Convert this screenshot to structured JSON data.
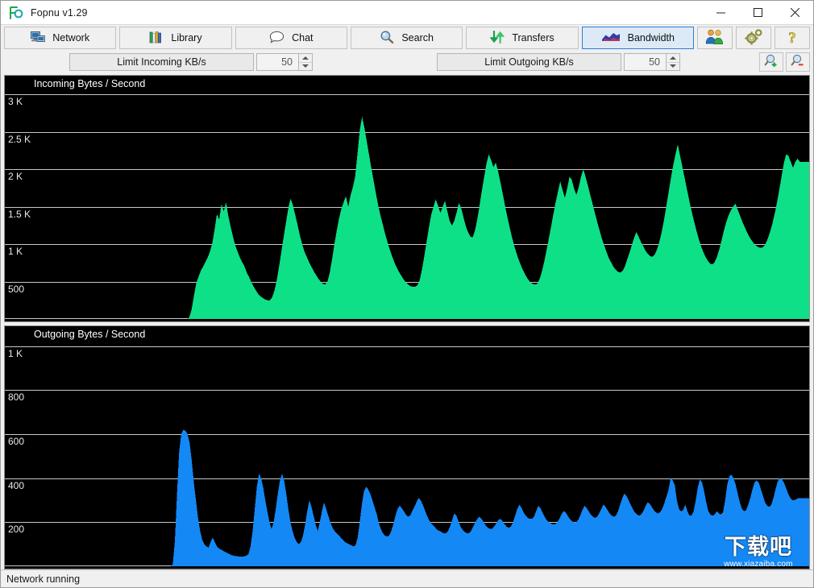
{
  "window": {
    "title": "Fopnu v1.29",
    "logo_icon": "fopnu-logo-icon",
    "minimize_icon": "minimize-icon",
    "maximize_icon": "maximize-icon",
    "close_icon": "close-icon"
  },
  "toolbar": {
    "buttons": [
      {
        "label": "Network",
        "icon": "network-computer-icon",
        "selected": false
      },
      {
        "label": "Library",
        "icon": "library-books-icon",
        "selected": false
      },
      {
        "label": "Chat",
        "icon": "chat-bubble-icon",
        "selected": false
      },
      {
        "label": "Search",
        "icon": "search-magnifier-icon",
        "selected": false
      },
      {
        "label": "Transfers",
        "icon": "transfers-arrows-icon",
        "selected": false
      },
      {
        "label": "Bandwidth",
        "icon": "bandwidth-graph-icon",
        "selected": true
      }
    ],
    "icon_buttons": [
      {
        "name": "users-button",
        "icon": "users-people-icon"
      },
      {
        "name": "settings-button",
        "icon": "gears-icon"
      },
      {
        "name": "help-button",
        "icon": "question-mark-icon"
      }
    ]
  },
  "limits": {
    "incoming_label": "Limit Incoming KB/s",
    "incoming_value": "50",
    "outgoing_label": "Limit Outgoing KB/s",
    "outgoing_value": "50",
    "zoom_in_icon": "zoom-in-magnifier-icon",
    "zoom_out_icon": "zoom-out-magnifier-icon"
  },
  "statusbar": {
    "text": "Network running"
  },
  "watermark": {
    "cn": "下载吧",
    "url": "www.xiazaiba.com"
  },
  "colors": {
    "incoming": "#0ee087",
    "outgoing": "#1488f5",
    "plot_background": "#000000",
    "gridline": "#c8c8c8",
    "accent": "#2a7fd4"
  },
  "chart_data": [
    {
      "type": "area",
      "name": "incoming",
      "title": "Incoming Bytes / Second",
      "xlabel": "",
      "ylabel": "Bytes / Second",
      "ylim": [
        0,
        3250
      ],
      "grid": true,
      "gridlines": [
        500,
        1000,
        1500,
        2000,
        2500,
        3000
      ],
      "tick_labels": [
        "500",
        "1 K",
        "1.5 K",
        "2 K",
        "2.5 K",
        "3 K"
      ],
      "color": "#0ee087",
      "legend": "none",
      "values": [
        0,
        0,
        0,
        0,
        0,
        0,
        0,
        0,
        0,
        0,
        0,
        0,
        0,
        0,
        0,
        0,
        0,
        0,
        0,
        0,
        0,
        0,
        0,
        0,
        0,
        0,
        0,
        0,
        0,
        0,
        0,
        0,
        0,
        0,
        0,
        0,
        0,
        0,
        0,
        0,
        0,
        0,
        0,
        0,
        0,
        0,
        0,
        0,
        0,
        0,
        0,
        0,
        0,
        0,
        0,
        0,
        0,
        0,
        0,
        0,
        0,
        0,
        0,
        0,
        0,
        0,
        0,
        0,
        0,
        0,
        0,
        0,
        0,
        0,
        0,
        0,
        0,
        0,
        0,
        0,
        20,
        120,
        300,
        470,
        560,
        640,
        700,
        760,
        820,
        900,
        1010,
        1190,
        1400,
        1330,
        1530,
        1440,
        1560,
        1370,
        1230,
        1100,
        980,
        900,
        820,
        760,
        700,
        620,
        560,
        490,
        430,
        380,
        330,
        300,
        280,
        260,
        250,
        250,
        290,
        380,
        520,
        700,
        900,
        1100,
        1290,
        1480,
        1610,
        1520,
        1390,
        1260,
        1120,
        1000,
        900,
        830,
        760,
        700,
        640,
        590,
        540,
        500,
        470,
        460,
        500,
        620,
        800,
        1000,
        1180,
        1340,
        1470,
        1560,
        1640,
        1500,
        1650,
        1760,
        1900,
        2200,
        2520,
        2700,
        2560,
        2380,
        2200,
        2020,
        1850,
        1680,
        1520,
        1380,
        1260,
        1140,
        1030,
        930,
        840,
        760,
        690,
        630,
        580,
        530,
        490,
        460,
        440,
        430,
        430,
        450,
        520,
        660,
        840,
        1030,
        1220,
        1390,
        1500,
        1600,
        1510,
        1420,
        1500,
        1580,
        1440,
        1310,
        1250,
        1310,
        1420,
        1550,
        1480,
        1360,
        1240,
        1160,
        1100,
        1090,
        1180,
        1330,
        1520,
        1720,
        1900,
        2080,
        2200,
        2120,
        2030,
        2090,
        1980,
        1830,
        1680,
        1520,
        1370,
        1230,
        1100,
        980,
        880,
        790,
        710,
        640,
        580,
        530,
        490,
        470,
        460,
        470,
        530,
        630,
        760,
        910,
        1070,
        1230,
        1400,
        1560,
        1700,
        1840,
        1720,
        1620,
        1740,
        1900,
        1860,
        1740,
        1660,
        1760,
        1900,
        2000,
        1900,
        1780,
        1660,
        1540,
        1420,
        1300,
        1190,
        1080,
        990,
        900,
        820,
        760,
        700,
        660,
        630,
        620,
        640,
        700,
        790,
        880,
        980,
        1080,
        1160,
        1100,
        1030,
        970,
        910,
        870,
        840,
        830,
        860,
        930,
        1030,
        1160,
        1320,
        1500,
        1690,
        1880,
        2050,
        2200,
        2330,
        2180,
        2030,
        1880,
        1730,
        1580,
        1440,
        1310,
        1190,
        1080,
        980,
        900,
        830,
        780,
        740,
        730,
        760,
        830,
        930,
        1050,
        1180,
        1290,
        1380,
        1450,
        1500,
        1540,
        1460,
        1380,
        1300,
        1230,
        1160,
        1100,
        1050,
        1010,
        980,
        960,
        950,
        960,
        1000,
        1070,
        1160,
        1270,
        1400,
        1550,
        1720,
        1900,
        2080,
        2200,
        2180,
        2100,
        2020,
        2100,
        2140,
        2100,
        2100,
        2100,
        2100,
        2100
      ]
    },
    {
      "type": "area",
      "name": "outgoing",
      "title": "Outgoing Bytes / Second",
      "xlabel": "",
      "ylabel": "Bytes / Second",
      "ylim": [
        0,
        1090
      ],
      "grid": true,
      "gridlines": [
        200,
        400,
        600,
        800,
        1000
      ],
      "tick_labels": [
        "200",
        "400",
        "600",
        "800",
        "1 K"
      ],
      "color": "#1488f5",
      "legend": "none",
      "values": [
        0,
        0,
        0,
        0,
        0,
        0,
        0,
        0,
        0,
        0,
        0,
        0,
        0,
        0,
        0,
        0,
        0,
        0,
        0,
        0,
        0,
        0,
        0,
        0,
        0,
        0,
        0,
        0,
        0,
        0,
        0,
        0,
        0,
        0,
        0,
        0,
        0,
        0,
        0,
        0,
        0,
        0,
        0,
        0,
        0,
        0,
        0,
        0,
        0,
        0,
        0,
        0,
        0,
        0,
        0,
        0,
        0,
        0,
        0,
        0,
        0,
        0,
        0,
        0,
        0,
        0,
        0,
        0,
        0,
        0,
        0,
        0,
        0,
        0,
        0,
        0,
        0,
        0,
        0,
        0,
        10,
        120,
        330,
        520,
        600,
        620,
        615,
        600,
        560,
        480,
        380,
        300,
        220,
        160,
        120,
        100,
        90,
        85,
        110,
        130,
        110,
        90,
        80,
        75,
        70,
        65,
        60,
        55,
        50,
        48,
        46,
        45,
        44,
        44,
        45,
        48,
        55,
        90,
        160,
        260,
        360,
        420,
        400,
        360,
        300,
        250,
        200,
        170,
        200,
        260,
        330,
        390,
        420,
        390,
        330,
        260,
        200,
        160,
        130,
        110,
        100,
        110,
        140,
        190,
        250,
        300,
        270,
        230,
        190,
        160,
        200,
        250,
        290,
        260,
        230,
        200,
        175,
        160,
        150,
        140,
        130,
        120,
        110,
        105,
        100,
        95,
        90,
        95,
        130,
        200,
        280,
        340,
        360,
        350,
        330,
        300,
        270,
        240,
        200,
        170,
        150,
        140,
        135,
        140,
        160,
        190,
        230,
        260,
        275,
        265,
        250,
        235,
        225,
        230,
        250,
        270,
        290,
        310,
        300,
        280,
        255,
        230,
        210,
        195,
        185,
        175,
        165,
        160,
        155,
        150,
        150,
        160,
        180,
        210,
        240,
        230,
        205,
        180,
        165,
        155,
        150,
        150,
        160,
        180,
        200,
        215,
        225,
        215,
        200,
        185,
        175,
        170,
        170,
        180,
        195,
        210,
        215,
        205,
        190,
        180,
        175,
        180,
        200,
        230,
        260,
        280,
        265,
        245,
        230,
        220,
        215,
        215,
        225,
        250,
        275,
        265,
        245,
        225,
        210,
        200,
        195,
        190,
        190,
        200,
        215,
        235,
        250,
        245,
        230,
        215,
        205,
        200,
        200,
        210,
        230,
        255,
        275,
        265,
        250,
        235,
        225,
        220,
        225,
        240,
        260,
        280,
        270,
        255,
        240,
        230,
        225,
        230,
        250,
        280,
        310,
        330,
        320,
        300,
        280,
        260,
        245,
        235,
        230,
        235,
        250,
        270,
        290,
        285,
        270,
        255,
        245,
        240,
        245,
        260,
        285,
        315,
        345,
        400,
        390,
        370,
        300,
        260,
        250,
        255,
        280,
        250,
        230,
        230,
        250,
        300,
        360,
        395,
        380,
        340,
        290,
        250,
        235,
        230,
        235,
        250,
        240,
        235,
        245,
        300,
        370,
        410,
        415,
        400,
        370,
        330,
        290,
        260,
        250,
        255,
        280,
        310,
        350,
        380,
        390,
        380,
        350,
        320,
        290,
        275,
        270,
        280,
        310,
        350,
        385,
        400,
        395,
        380,
        355,
        330,
        310,
        300,
        300,
        305,
        310,
        310,
        310,
        310,
        310,
        310
      ]
    }
  ]
}
